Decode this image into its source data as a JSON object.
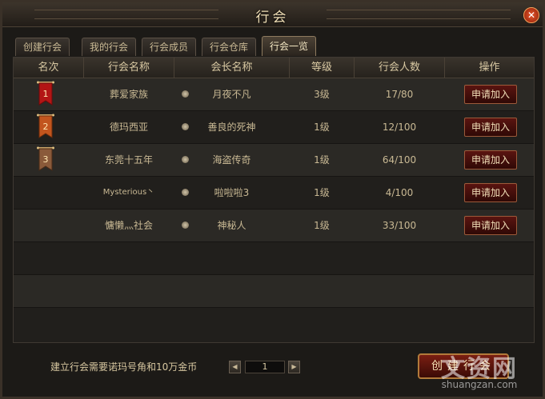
{
  "window": {
    "title": "行会",
    "close_label": "✕"
  },
  "tabs": [
    {
      "label": "创建行会",
      "active": false
    },
    {
      "label": "我的行会",
      "active": false
    },
    {
      "label": "行会成员",
      "active": false
    },
    {
      "label": "行会仓库",
      "active": false
    },
    {
      "label": "行会一览",
      "active": true
    }
  ],
  "table": {
    "headers": [
      "名次",
      "行会名称",
      "会长名称",
      "等级",
      "行会人数",
      "操作"
    ],
    "rows": [
      {
        "rank": "1",
        "guild": "葬爱家族",
        "leader": "月夜不凡",
        "level": "3级",
        "members": "17/80",
        "action": "申请加入"
      },
      {
        "rank": "2",
        "guild": "德玛西亚",
        "leader": "善良的死神",
        "level": "1级",
        "members": "12/100",
        "action": "申请加入"
      },
      {
        "rank": "3",
        "guild": "东莞十五年",
        "leader": "海盗传奇",
        "level": "1级",
        "members": "64/100",
        "action": "申请加入"
      },
      {
        "rank": "",
        "guild": "Mysterious丶",
        "leader": "啦啦啦3",
        "level": "1级",
        "members": "4/100",
        "action": "申请加入"
      },
      {
        "rank": "",
        "guild": "慵懒灬社会",
        "leader": "神秘人",
        "level": "1级",
        "members": "33/100",
        "action": "申请加入"
      }
    ]
  },
  "footer": {
    "notice": "建立行会需要诺玛号角和10万金币",
    "page": "1",
    "create_label": "创建行会"
  },
  "banner_colors": [
    "#b31515",
    "#c2551e",
    "#8a5a3a"
  ],
  "watermark": {
    "main": "文资网",
    "sub": "shuangzan.com"
  }
}
